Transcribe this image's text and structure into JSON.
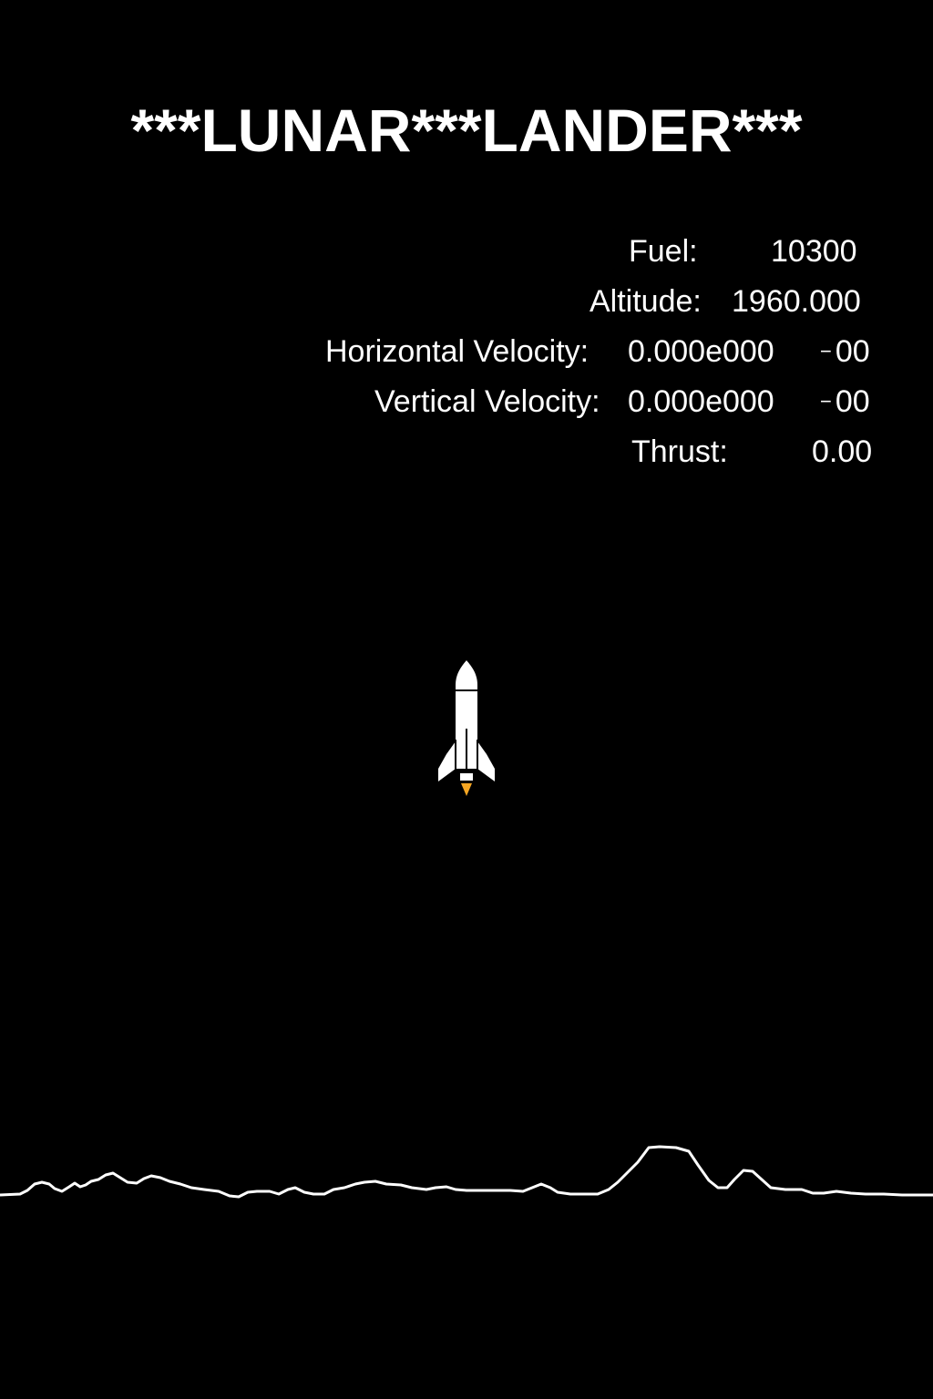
{
  "title": "***LUNAR***LANDER***",
  "hud": {
    "fuel": {
      "label": "Fuel:",
      "value": "10300"
    },
    "altitude": {
      "label": "Altitude:",
      "value": "1960.000"
    },
    "horizontal_velocity": {
      "label": "Horizontal Velocity:",
      "value": "0.000e000",
      "exp": "00"
    },
    "vertical_velocity": {
      "label": "Vertical Velocity:",
      "value": "0.000e000",
      "exp": "00"
    },
    "thrust": {
      "label": "Thrust:",
      "value": "0.00"
    }
  },
  "sprites": {
    "lander": "rocket-icon",
    "flame_color": "#f5a623"
  },
  "colors": {
    "background": "#000000",
    "foreground": "#ffffff"
  }
}
